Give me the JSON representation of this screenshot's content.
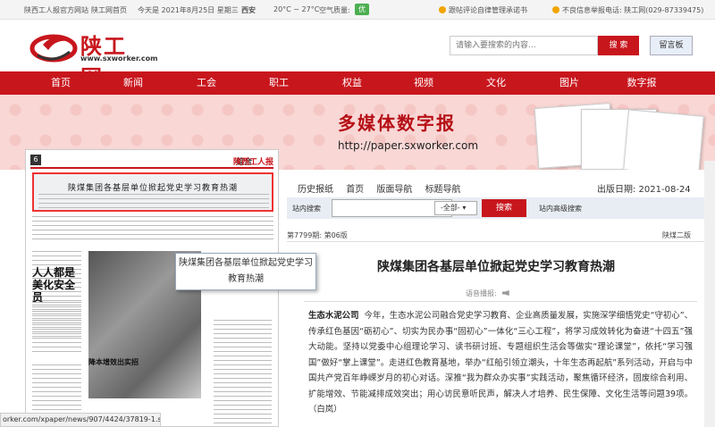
{
  "topbar": {
    "site_name": "陕西工人报官方网站",
    "home_link": "陕工网首页",
    "date": "今天是 2021年8月25日 星期三",
    "city": "西安",
    "temp": "20°C ~ 27°C",
    "air_label": "空气质量:",
    "air_value": "优",
    "report_link": "跟帖评论自律管理承诺书",
    "hotline": "不良信息举报电话: 陕工网(029-87339475)"
  },
  "logo": {
    "text": "陕工网",
    "url": "www.sxworker.com"
  },
  "search": {
    "placeholder": "请输入要搜索的内容...",
    "button": "搜 索",
    "guestbook": "留言板"
  },
  "nav": [
    "首页",
    "新闻",
    "工会",
    "职工",
    "权益",
    "视频",
    "文化",
    "图片",
    "数字报"
  ],
  "banner": {
    "title": "多媒体数字报",
    "url": "http://paper.sxworker.com"
  },
  "newspaper": {
    "page_no": "6",
    "section": "综合",
    "brand": "陕西工人报",
    "headline": "陕煤集团各基层单位掀起党史学习教育热潮",
    "side_title": "人人都是美化安全员",
    "sub_headline": "降本增效出实招"
  },
  "tooltip": "陕煤集团各基层单位掀起党史学习教育热潮",
  "tabs": [
    "历史报纸",
    "首页",
    "版面导航",
    "标题导航"
  ],
  "pub_date": "出版日期: 2021-08-24",
  "site_search": {
    "label": "站内搜索",
    "scope": "-全部-",
    "button": "搜索",
    "advanced": "站内高级搜索"
  },
  "edition": "第7799期: 第06版",
  "edition_right": "陕煤二版",
  "article": {
    "title": "陕煤集团各基层单位掀起党史学习教育热潮",
    "voice": "语音播报:",
    "lead": "生态水泥公司",
    "body": "今年，生态水泥公司融合党史学习教育、企业高质量发展，实施深学细悟党史“守初心”、传承红色基因“砺初心”、切实为民办事“固初心”一体化“三心工程”，将学习成效转化为奋进“十四五”强大动能。坚持以党委中心组理论学习、读书研讨班、专题组织生活会等做实“理论课堂”，依托“学习强国”做好“掌上课堂”。走进红色教育基地，举办“红船引领立潮头，十年生态再起航”系列活动，开启与中国共产党百年峥嵘岁月的初心对话。深推“我为群众办实事”实践活动，聚焦循环经济，固废综合利用、扩能增效、节能减排成效突出；用心访民意听民声，解决人才培养、民生保障、文化生活等问题39项。（白岚）"
  },
  "status_url": "orker.com/xpaper/news/907/4424/37819-1.shtml"
}
